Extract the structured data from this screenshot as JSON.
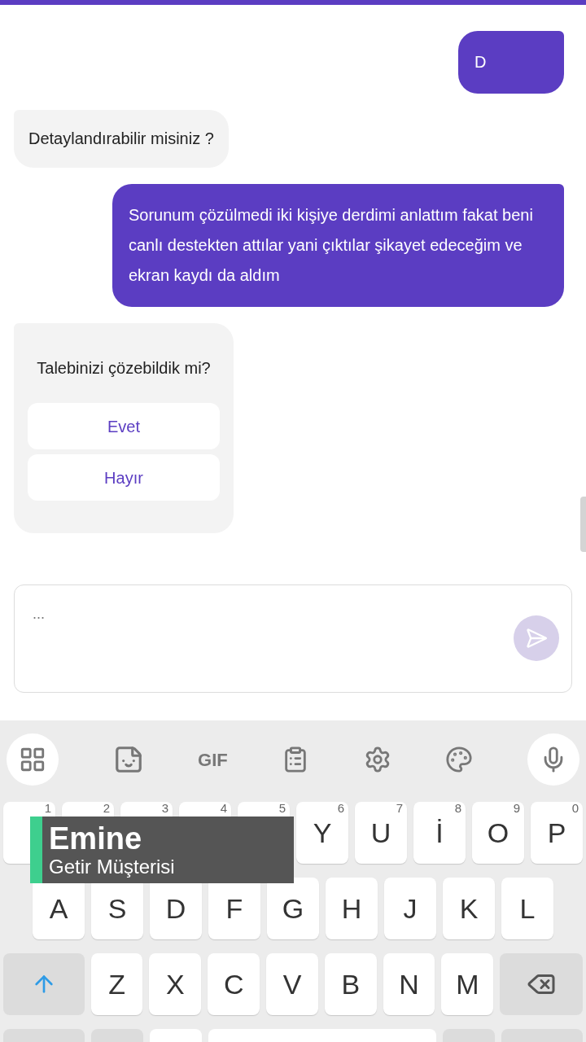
{
  "messages": [
    {
      "kind": "user",
      "text": "D"
    },
    {
      "kind": "bot",
      "text": "Detaylandırabilir misiniz ?"
    },
    {
      "kind": "user",
      "text": "Sorunum çözülmedi iki kişiye derdimi anlattım fakat beni canlı destekten attılar yani çıktılar şikayet edeceğim ve ekran kaydı da aldım"
    },
    {
      "kind": "options",
      "text": "Talebinizi çözebildik mi?",
      "options": [
        {
          "label": "Evet"
        },
        {
          "label": "Hayır"
        }
      ]
    }
  ],
  "composer": {
    "placeholder": "...",
    "send_disabled": true
  },
  "keyboard": {
    "toolbar_gif": "GIF",
    "rows": [
      [
        {
          "hint": "1"
        },
        {
          "hint": "2"
        },
        {
          "hint": "3"
        },
        {
          "hint": "4"
        },
        {
          "hint": "5"
        },
        {
          "label": "Y",
          "hint": "6"
        },
        {
          "label": "U",
          "hint": "7"
        },
        {
          "label": "İ",
          "hint": "8"
        },
        {
          "label": "O",
          "hint": "9"
        },
        {
          "label": "P",
          "hint": "0"
        }
      ],
      [
        {
          "label": "A"
        },
        {
          "label": "S"
        },
        {
          "label": "D"
        },
        {
          "label": "F"
        },
        {
          "label": "G"
        },
        {
          "label": "H"
        },
        {
          "label": "J"
        },
        {
          "label": "K"
        },
        {
          "label": "L"
        }
      ],
      [
        {
          "label": "Z"
        },
        {
          "label": "X"
        },
        {
          "label": "C"
        },
        {
          "label": "V"
        },
        {
          "label": "B"
        },
        {
          "label": "N"
        },
        {
          "label": "M"
        }
      ]
    ]
  },
  "lower_third": {
    "name": "Emine",
    "subtitle": "Getir Müşterisi"
  }
}
